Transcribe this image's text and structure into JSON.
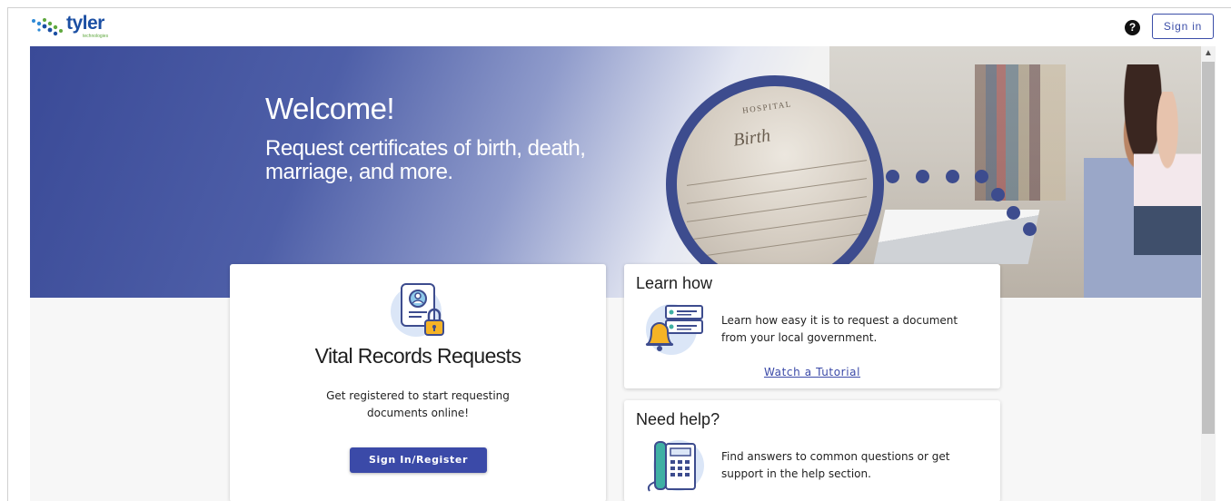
{
  "header": {
    "logo_text": "tyler",
    "logo_subtext": "technologies",
    "help_icon": "question-circle-icon",
    "signin_label": "Sign in"
  },
  "hero": {
    "welcome": "Welcome!",
    "tagline": "Request certificates of birth, death, marriage, and more.",
    "document_text_1": "HOSPITAL",
    "document_text_2": "Birth"
  },
  "main_card": {
    "icon": "id-badge-lock-icon",
    "title": "Vital Records Requests",
    "description": "Get registered to start requesting documents online!",
    "button_label": "Sign In/Register"
  },
  "learn_card": {
    "title": "Learn how",
    "icon": "bell-list-icon",
    "text": "Learn how easy it is to request a document from your local government.",
    "link_label": "Watch a Tutorial"
  },
  "help_card": {
    "title": "Need help?",
    "icon": "phone-icon",
    "text": "Find answers to common questions or get support in the help section."
  },
  "colors": {
    "primary": "#3b4aa8",
    "hero_blue": "#3d4c8e",
    "logo_blue": "#1b4fa3",
    "logo_green": "#5fa83e"
  }
}
